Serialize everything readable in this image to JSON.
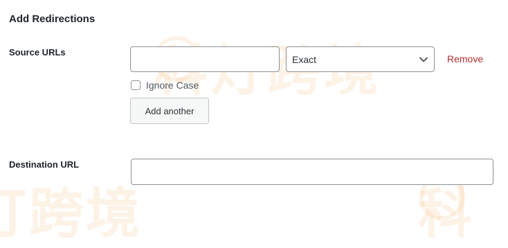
{
  "section": {
    "title": "Add Redirections"
  },
  "source": {
    "label": "Source URLs",
    "url_value": "",
    "match_type": "Exact",
    "remove_label": "Remove",
    "ignore_case_label": "Ignore Case",
    "ignore_case_checked": false,
    "add_another_label": "Add another"
  },
  "destination": {
    "label": "Destination URL",
    "url_value": ""
  },
  "watermark": {
    "text_1": "科灯跨境",
    "text_2": "灯跨境",
    "text_3": "科"
  },
  "colors": {
    "remove_link": "#b32d2e",
    "watermark": "#f4c48b",
    "input_border": "#8c8f94",
    "button_bg": "#f6f7f7"
  }
}
